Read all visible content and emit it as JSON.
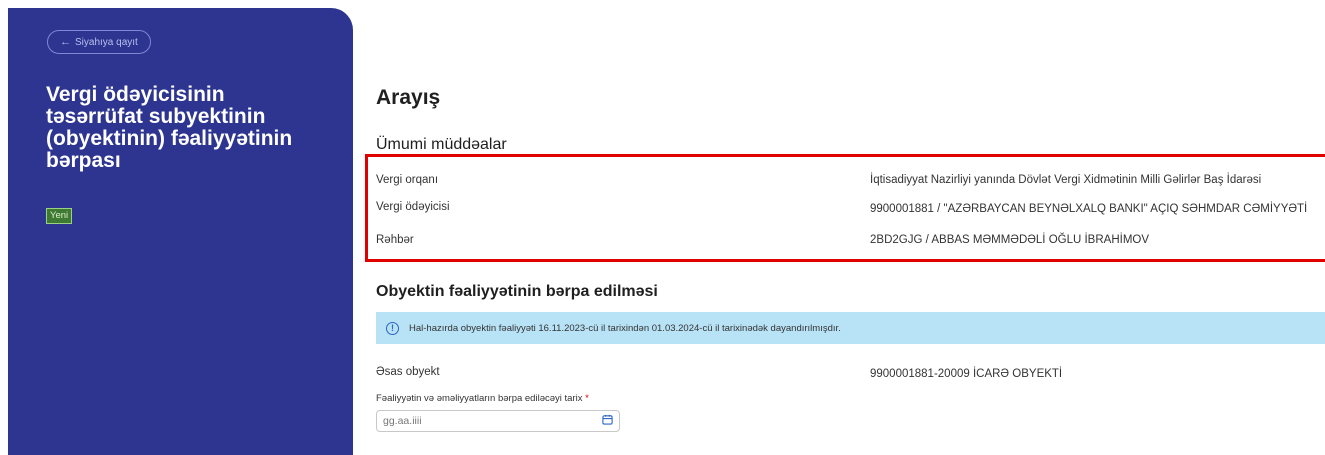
{
  "sidebar": {
    "back_label": "Siyahıya qayıt",
    "title": "Vergi ödəyicisinin təsərrüfat subyektinin (obyektinin) fəaliyyətinin bərpası",
    "badge": "Yeni"
  },
  "main": {
    "page_title": "Arayış",
    "general_section": {
      "title": "Ümumi müddəalar",
      "rows": [
        {
          "label": "Vergi orqanı",
          "value": "İqtisadiyyat Nazirliyi yanında Dövlət Vergi Xidmətinin Milli Gəlirlər Baş İdarəsi"
        },
        {
          "label": "Vergi ödəyicisi",
          "value": "9900001881 / \"AZƏRBAYCAN BEYNƏLXALQ BANKI\" AÇIQ SƏHMDAR CƏMİYYƏTİ"
        },
        {
          "label": "Rəhbər",
          "value": "2BD2GJG / ABBAS MƏMMƏDƏLİ OĞLU İBRAHİMOV"
        }
      ]
    },
    "restore_section": {
      "title": "Obyektin fəaliyyətinin bərpa edilməsi",
      "alert": "Hal-hazırda obyektin fəaliyyəti 16.11.2023-cü il tarixindən 01.03.2024-cü il tarixinədək dayandırılmışdır.",
      "object_label": "Əsas obyekt",
      "object_value": "9900001881-20009 İCARƏ OBYEKTİ",
      "date_field_label": "Fəaliyyətin və əməliyyatların bərpa ediləcəyi tarix",
      "date_required_mark": "*",
      "date_placeholder": "gg.aa.iiii"
    }
  },
  "colors": {
    "sidebar_bg": "#2d3590",
    "highlight_border": "#e00000",
    "alert_bg": "#b8e2f5",
    "badge_bg": "#3e7a34"
  },
  "icons": {
    "back": "arrow-left-icon",
    "alert": "info-icon",
    "date": "calendar-icon"
  }
}
